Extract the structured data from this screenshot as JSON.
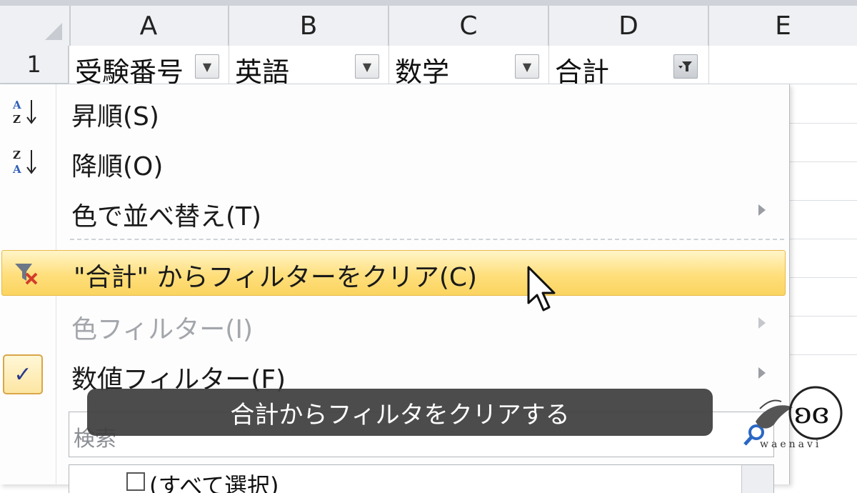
{
  "columns": [
    "A",
    "B",
    "C",
    "D",
    "E"
  ],
  "row_number": "1",
  "header_cells": [
    {
      "text": "受験番号"
    },
    {
      "text": "英語"
    },
    {
      "text": "数学"
    },
    {
      "text": "合計"
    }
  ],
  "menu": {
    "items": [
      {
        "label": "昇順(S)",
        "icon": "sort-ascending-icon"
      },
      {
        "label": "降順(O)",
        "icon": "sort-descending-icon"
      },
      {
        "label": "色で並べ替え(T)",
        "submenu": true
      },
      {
        "label": "\"合計\" からフィルターをクリア(C)",
        "icon": "clear-filter-icon",
        "highlighted": true
      },
      {
        "label": "色フィルター(I)",
        "disabled": true,
        "submenu": true
      },
      {
        "label": "数値フィルター(F)",
        "checked": true,
        "submenu": true
      }
    ],
    "search_placeholder": "検索",
    "select_all_label": "(すべて選択)"
  },
  "caption": "合計からフィルタをクリアする",
  "logo_text": "waenavi",
  "colors": {
    "highlight": "#ffdf7c",
    "caption_bg": "#3e3e3e",
    "disabled_text": "#a3a6ab"
  }
}
